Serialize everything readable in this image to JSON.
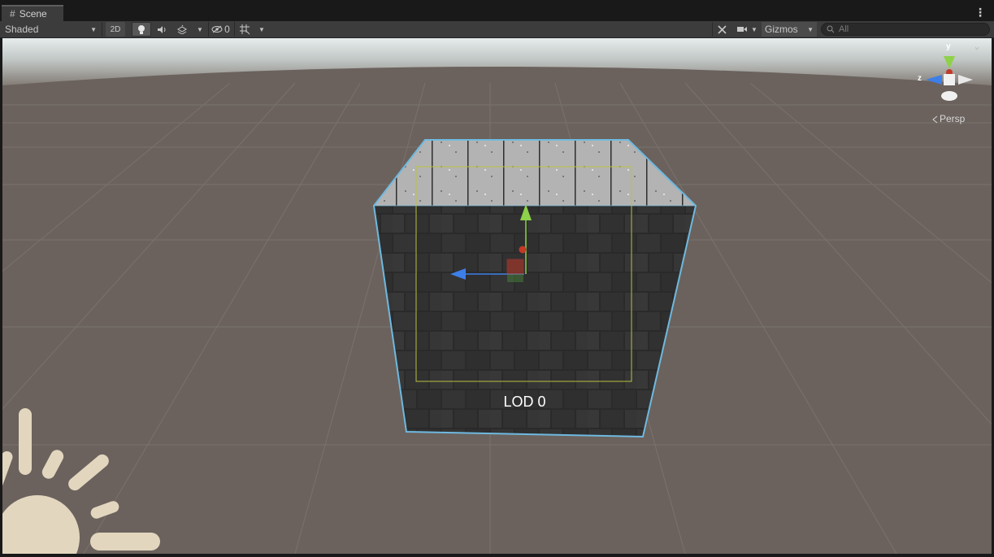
{
  "tab": {
    "icon": "grid-icon",
    "label": "Scene"
  },
  "toolbar": {
    "draw_mode": "Shaded",
    "mode_2d": "2D",
    "hidden_count": "0",
    "gizmos": "Gizmos",
    "search_placeholder": "All",
    "icons": [
      "lightbulb-icon",
      "audio-icon",
      "effects-icon",
      "visibility-icon",
      "grid-snap-icon",
      "tools-icon",
      "camera-icon",
      "search-icon"
    ]
  },
  "viewport": {
    "lod_label": "LOD 0",
    "gizmo": {
      "y_label": "y",
      "z_label": "z",
      "projection": "Persp"
    },
    "colors": {
      "ground": "#6b625d",
      "sky_top": "#e4eaea",
      "selection_outline": "#6fb9e0",
      "bounds": "#b8c040",
      "sun": "#e3d6bf"
    }
  }
}
